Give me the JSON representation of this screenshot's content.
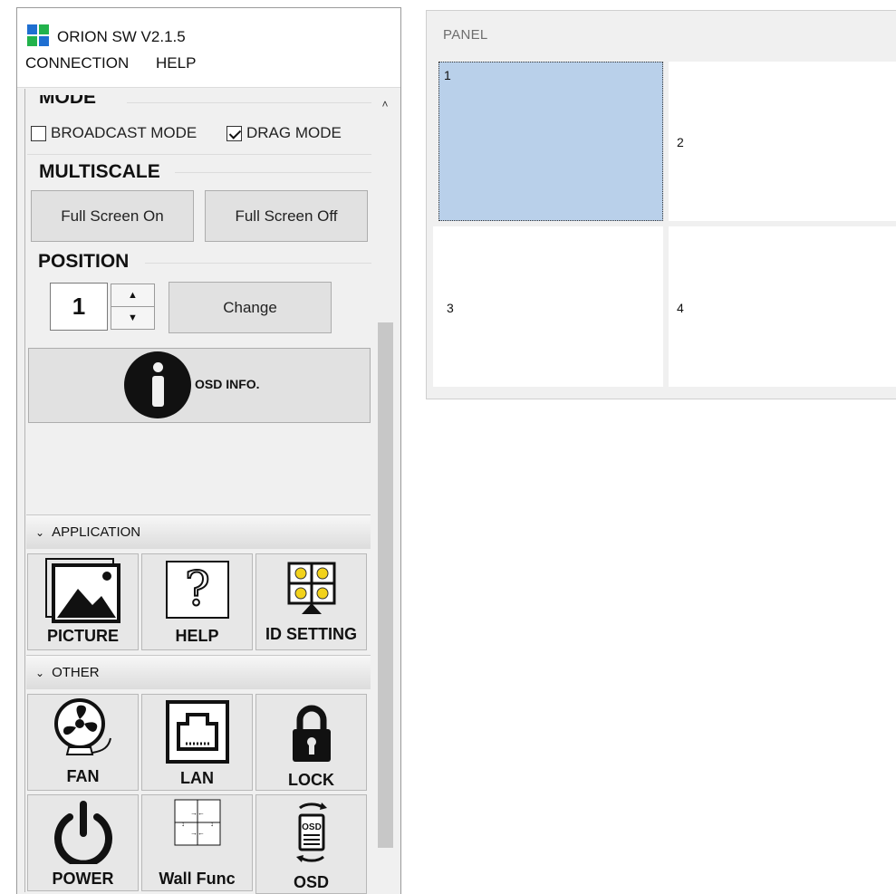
{
  "app": {
    "title": "ORION SW V2.1.5",
    "logo_colors": [
      "#1f6fd1",
      "#22b24c",
      "#22b24c",
      "#1f6fd1"
    ]
  },
  "menu": [
    "CONNECTION",
    "HELP"
  ],
  "mode": {
    "heading": "MODE",
    "options": [
      {
        "label": "BROADCAST MODE",
        "checked": false
      },
      {
        "label": "DRAG MODE",
        "checked": true
      }
    ]
  },
  "multiscale": {
    "heading": "MULTISCALE",
    "buttons": [
      "Full Screen On",
      "Full Screen Off"
    ]
  },
  "position": {
    "heading": "POSITION",
    "value": "1",
    "change_label": "Change"
  },
  "osd_info_label": "OSD INFO.",
  "application": {
    "header": "APPLICATION",
    "tiles": [
      {
        "label": "PICTURE",
        "icon": "picture-icon"
      },
      {
        "label": "HELP",
        "icon": "help-icon"
      },
      {
        "label": "ID SETTING",
        "icon": "id-setting-icon"
      }
    ]
  },
  "other": {
    "header": "OTHER",
    "tiles": [
      {
        "label": "FAN",
        "icon": "fan-icon"
      },
      {
        "label": "LAN",
        "icon": "lan-icon"
      },
      {
        "label": "LOCK",
        "icon": "lock-icon"
      },
      {
        "label": "POWER",
        "icon": "power-icon"
      },
      {
        "label": "Wall Func",
        "icon": "wall-func-icon"
      },
      {
        "label": "OSD",
        "icon": "osd-icon"
      }
    ]
  },
  "panel": {
    "title": "PANEL",
    "cells": [
      {
        "id": "1",
        "selected": true
      },
      {
        "id": "2",
        "selected": false
      },
      {
        "id": "3",
        "selected": false
      },
      {
        "id": "4",
        "selected": false
      }
    ],
    "selection_color": "#b9d0ea"
  }
}
